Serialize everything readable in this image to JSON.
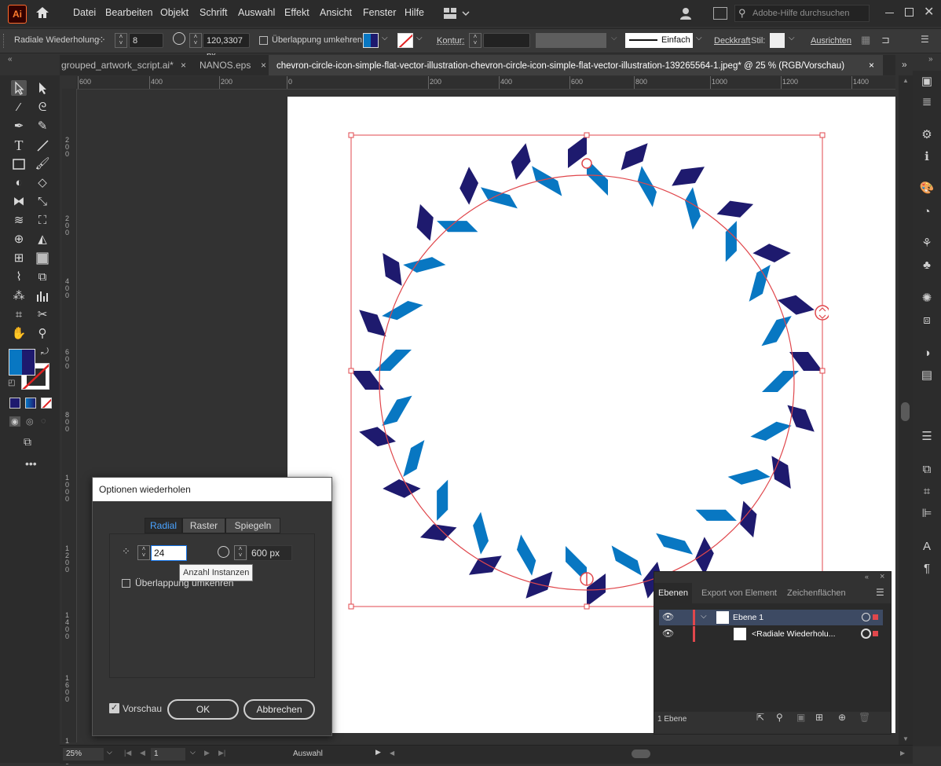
{
  "menubar": {
    "logo": "Ai",
    "items": [
      "Datei",
      "Bearbeiten",
      "Objekt",
      "Schrift",
      "Auswahl",
      "Effekt",
      "Ansicht",
      "Fenster",
      "Hilfe"
    ],
    "help_search_placeholder": "Adobe-Hilfe durchsuchen"
  },
  "controlbar": {
    "object_label": "Radiale Wiederholung",
    "instances_value": "8",
    "radius_value": "120,3307 px",
    "reverse_overlap_label": "Überlappung umkehren",
    "stroke_label": "Kontur:",
    "stroke_style": "Einfach",
    "opacity_label": "Deckkraft",
    "style_label": "Stil:",
    "align_label": "Ausrichten"
  },
  "tabs": [
    {
      "label": "grouped_artwork_script.ai*",
      "active": false
    },
    {
      "label": "NANOS.eps",
      "active": false
    },
    {
      "label": "chevron-circle-icon-simple-flat-vector-illustration-chevron-circle-icon-simple-flat-vector-illustration-139265564-1.jpeg* @ 25 % (RGB/Vorschau)",
      "active": true
    }
  ],
  "ruler": {
    "h_labels": [
      "600",
      "400",
      "200",
      "0",
      "200",
      "400",
      "600",
      "800",
      "1000",
      "1200",
      "1400",
      "1600"
    ],
    "v_labels": [
      "2",
      "0",
      "0",
      "2",
      "0",
      "0",
      "4",
      "0",
      "0",
      "6",
      "0",
      "0",
      "8",
      "0",
      "0",
      "1",
      "0",
      "0",
      "0",
      "1",
      "2",
      "0",
      "0",
      "1",
      "4",
      "0",
      "0",
      "1",
      "6",
      "0",
      "0",
      "1",
      "8",
      "0",
      "0"
    ]
  },
  "artwork": {
    "chevron_count": 24,
    "color_dark": "#1e1a6e",
    "color_light": "#0877c2",
    "selection_color": "#e0474c"
  },
  "dialog": {
    "title": "Optionen wiederholen",
    "tabs": [
      "Radial",
      "Raster",
      "Spiegeln"
    ],
    "active_tab": "Radial",
    "instances_value": "24",
    "radius_value": "600 px",
    "tooltip": "Anzahl Instanzen",
    "overlap_label": "Überlappung umkehren",
    "preview_label": "Vorschau",
    "preview_checked": true,
    "ok_label": "OK",
    "cancel_label": "Abbrechen"
  },
  "layers_panel": {
    "tabs": [
      "Ebenen",
      "Export von Element",
      "Zeichenflächen"
    ],
    "rows": [
      {
        "name": "Ebene 1"
      },
      {
        "name": "<Radiale Wiederholu..."
      }
    ],
    "footer": "1 Ebene"
  },
  "status": {
    "zoom": "25%",
    "artboard_number": "1",
    "mode": "Auswahl"
  }
}
